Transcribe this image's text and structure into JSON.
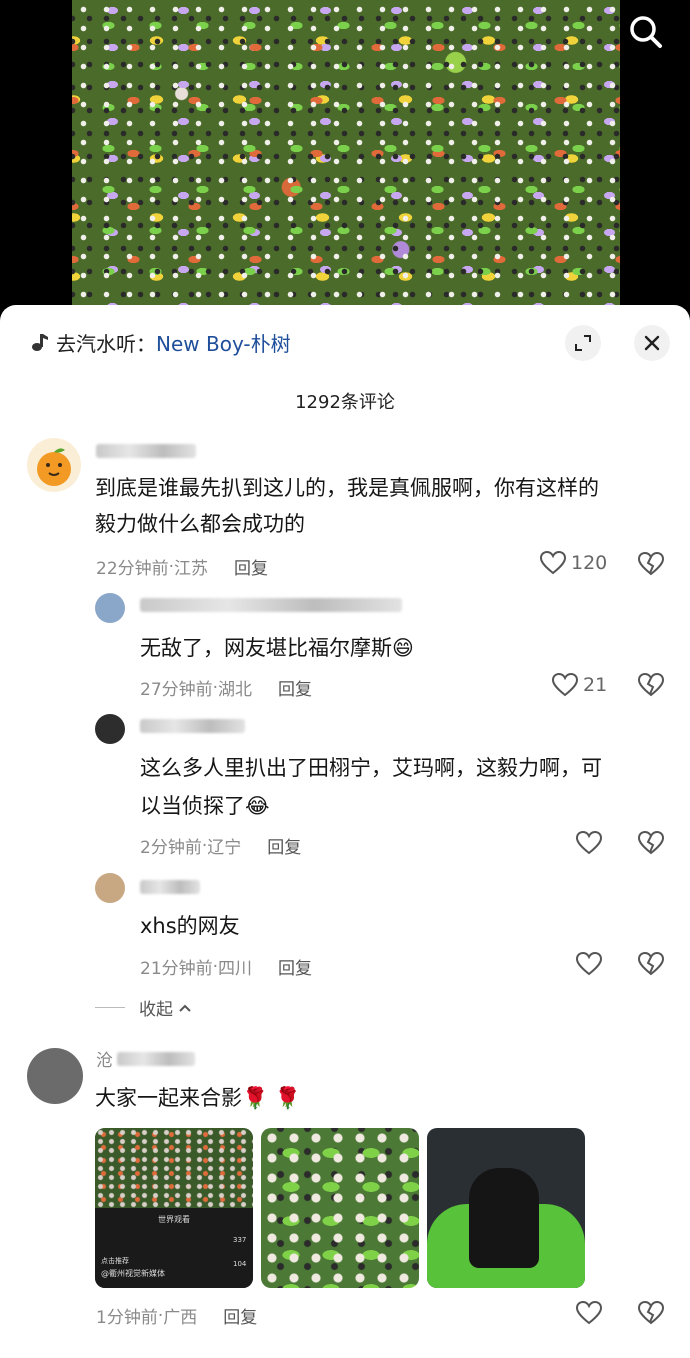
{
  "header": {
    "music_prefix": "去汽水听：",
    "music_link": "New Boy-朴树"
  },
  "comments_count": "1292条评论",
  "comments": [
    {
      "text_line1": "到底是谁最先扒到这儿的，我是真佩服啊，你有这样的",
      "text_line2": "毅力做什么都会成功的",
      "time": "22分钟前",
      "location": "江苏",
      "reply": "回复",
      "likes": "120"
    },
    {
      "text": "无敌了，网友堪比福尔摩斯😄",
      "time": "27分钟前",
      "location": "湖北",
      "reply": "回复",
      "likes": "21"
    },
    {
      "text_line1": "这么多人里扒出了田栩宁，艾玛啊，这毅力啊，可",
      "text_line2": "以当侦探了😂",
      "time": "2分钟前",
      "location": "辽宁",
      "reply": "回复"
    },
    {
      "text": "xhs的网友",
      "time": "21分钟前",
      "location": "四川",
      "reply": "回复"
    },
    {
      "username": "沧",
      "text": "大家一起来合影🌹 🌹",
      "time": "1分钟前",
      "location": "广西",
      "reply": "回复"
    }
  ],
  "collapse_label": "收起",
  "meta_separator": " · ",
  "thumb1": {
    "caption": "世界观看",
    "tag": "点击推荐",
    "source": "@衢州视觉新媒体",
    "count1": "337",
    "count2": "104"
  },
  "icons": {
    "search": "search-icon",
    "expand": "expand-icon",
    "close": "close-icon",
    "like": "heart-icon",
    "dislike": "broken-heart-icon",
    "music": "music-note-icon"
  },
  "colors": {
    "link": "#1f4f9a",
    "meta": "#8a8a8a"
  }
}
